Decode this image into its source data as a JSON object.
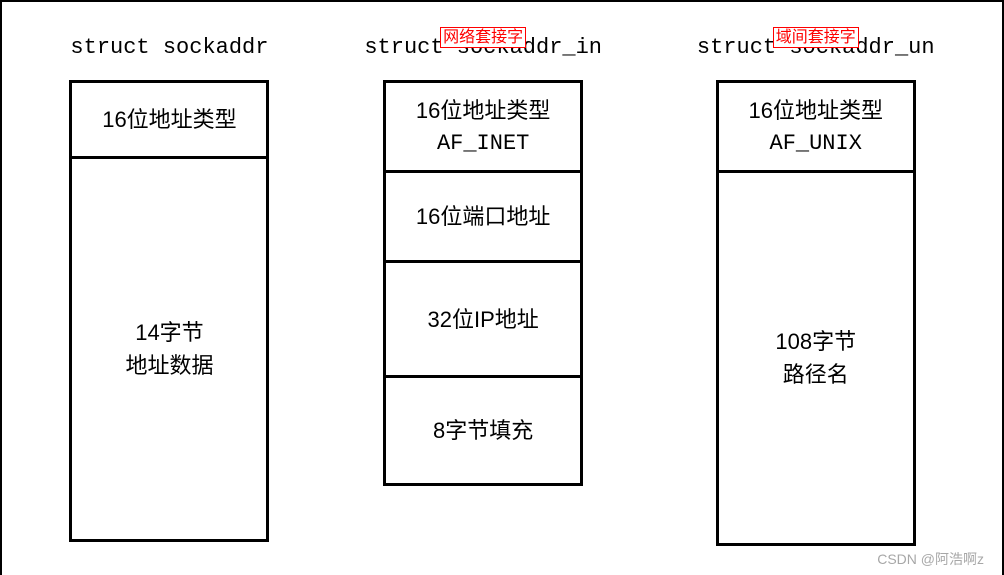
{
  "columns": [
    {
      "annotation": null,
      "title": "struct sockaddr",
      "cells": [
        {
          "lines": [
            "16位地址类型"
          ]
        },
        {
          "lines": [
            "14字节",
            "地址数据"
          ]
        }
      ]
    },
    {
      "annotation": "网络套接字",
      "title": "struct sockaddr_in",
      "cells": [
        {
          "lines": [
            "16位地址类型",
            "AF_INET"
          ],
          "mono_idx": 1
        },
        {
          "lines": [
            "16位端口地址"
          ]
        },
        {
          "lines": [
            "32位IP地址"
          ]
        },
        {
          "lines": [
            "8字节填充"
          ]
        }
      ]
    },
    {
      "annotation": "域间套接字",
      "title": "struct sockaddr_un",
      "cells": [
        {
          "lines": [
            "16位地址类型",
            "AF_UNIX"
          ],
          "mono_idx": 1
        },
        {
          "lines": [
            "108字节",
            "路径名"
          ]
        }
      ]
    }
  ],
  "watermark": "CSDN @阿浩啊z"
}
